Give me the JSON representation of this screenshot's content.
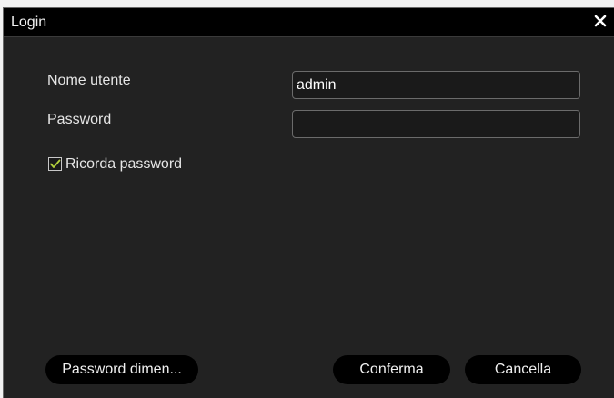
{
  "dialog": {
    "title": "Login",
    "close_icon": "close-icon"
  },
  "form": {
    "username_label": "Nome utente",
    "username_value": "admin",
    "password_label": "Password",
    "password_value": "",
    "remember": {
      "label": "Ricorda password",
      "checked": true,
      "check_color": "#b4d23c"
    }
  },
  "buttons": {
    "forgot_label": "Password dimen...",
    "confirm_label": "Conferma",
    "cancel_label": "Cancella"
  },
  "colors": {
    "dialog_background": "#222222",
    "titlebar_background": "#000000",
    "text": "#e6e6e6"
  }
}
